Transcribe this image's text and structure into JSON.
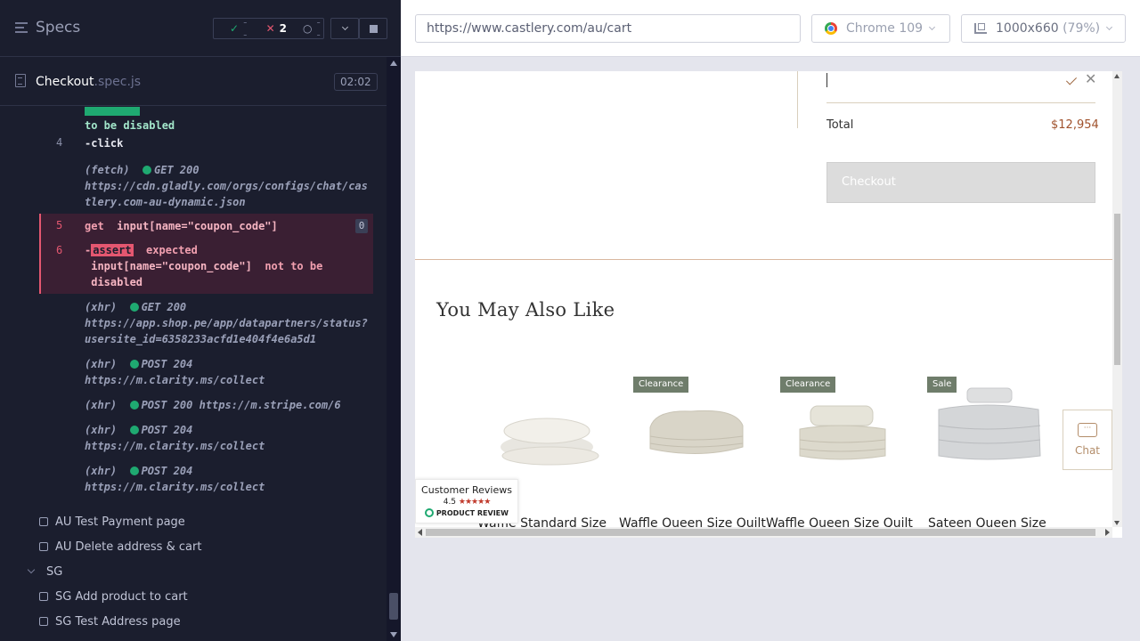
{
  "reporter": {
    "title": "Specs",
    "stats": {
      "passed": "--",
      "failed": "2",
      "pending": "--"
    },
    "spec_file": {
      "name": "Checkout",
      "ext": ".spec.js",
      "duration": "02:02"
    },
    "commands": [
      {
        "id": "c0",
        "num": "",
        "lines": [
          "to be  disabled"
        ]
      },
      {
        "id": "c4",
        "num": "4",
        "name": "-click"
      },
      {
        "id": "c4b",
        "method": "(fetch)",
        "status": "GET 200",
        "url": "https://cdn.gladly.com/orgs/configs/chat/castlery.com-au-dynamic.json"
      },
      {
        "id": "c5",
        "num": "5",
        "name": "get",
        "arg": "input[name=\"coupon_code\"]",
        "badge": "0"
      },
      {
        "id": "c6",
        "num": "6",
        "name": "assert",
        "msg_1": "expected",
        "subject": "input[name=\"coupon_code\"]",
        "msg_2": "not to be",
        "msg_3": "disabled"
      }
    ],
    "requests": [
      {
        "method": "(xhr)",
        "status": "GET 200",
        "url": "https://app.shop.pe/app/datapartners/status?usersite_id=6358233acfd1e404f4e6a5d1"
      },
      {
        "method": "(xhr)",
        "status": "POST 204",
        "url": "https://m.clarity.ms/collect"
      },
      {
        "method": "(xhr)",
        "status": "POST 200",
        "url": "https://m.stripe.com/6"
      },
      {
        "method": "(xhr)",
        "status": "POST 204",
        "url": "https://m.clarity.ms/collect"
      },
      {
        "method": "(xhr)",
        "status": "POST 204",
        "url": "https://m.clarity.ms/collect"
      }
    ],
    "tests": [
      {
        "label": "AU Test Payment page"
      },
      {
        "label": "AU Delete address & cart"
      }
    ],
    "folder": "SG",
    "sg_tests": [
      {
        "label": "SG Add product to cart"
      },
      {
        "label": "SG Test Address page"
      }
    ]
  },
  "browser": {
    "url": "https://www.castlery.com/au/cart",
    "browser_name": "Chrome 109",
    "viewport": "1000x660",
    "zoom": "(79%)"
  },
  "page": {
    "total_label": "Total",
    "total_value": "$12,954",
    "checkout_label": "Checkout",
    "section_title": "You May Also Like",
    "products": [
      {
        "tag": "",
        "name": "Waffle Standard Size"
      },
      {
        "tag": "Clearance",
        "name": "Waffle Queen Size Quilt"
      },
      {
        "tag": "Clearance",
        "name": "Waffle Queen Size Quilt"
      },
      {
        "tag": "Sale",
        "name": "Sateen Queen Size"
      }
    ],
    "chat_label": "Chat",
    "reviews": {
      "title": "Customer Reviews",
      "rating": "4.5",
      "brand": "PRODUCT REVIEW"
    }
  },
  "colors": {
    "accent_fail": "#e45770",
    "accent_pass": "#1fa971",
    "price": "#a0522d"
  }
}
